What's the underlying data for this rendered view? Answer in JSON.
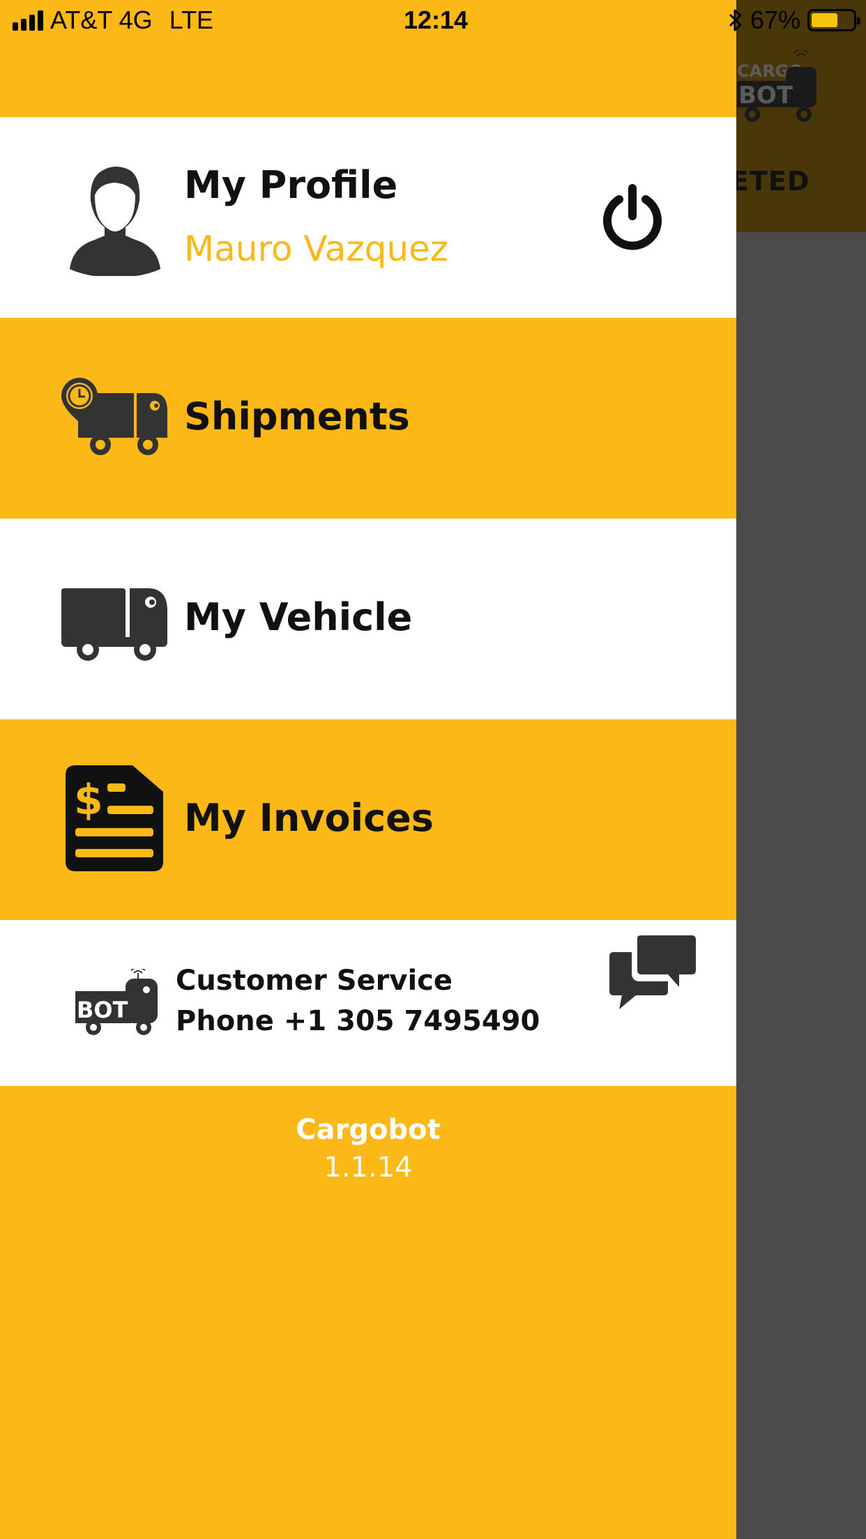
{
  "status_bar": {
    "carrier": "AT&T 4G",
    "network": "LTE",
    "time": "12:14",
    "bluetooth_icon": "bluetooth-icon",
    "battery_percent": "67%",
    "battery_level": 0.67,
    "battery_color": "#f7c40c"
  },
  "background_app": {
    "logo_text_top": "CARGO",
    "logo_text_bottom": "BOT",
    "tab_text_fragment": "ETED"
  },
  "drawer": {
    "profile": {
      "title": "My Profile",
      "name": "Mauro Vazquez",
      "avatar_icon": "user-avatar-icon",
      "logout_icon": "power-icon"
    },
    "items": [
      {
        "label": "Shipments",
        "icon": "truck-clock-icon"
      },
      {
        "label": "My Vehicle",
        "icon": "truck-icon"
      },
      {
        "label": "My Invoices",
        "icon": "invoice-icon"
      }
    ],
    "customer_service": {
      "line1": "Customer Service",
      "line2": "Phone +1 305 7495490",
      "logo_text": "BOT",
      "chat_icon": "chat-icon"
    },
    "footer": {
      "app_name": "Cargobot",
      "version": "1.1.14"
    }
  },
  "colors": {
    "accent": "#fbb816",
    "dark": "#333333",
    "white": "#ffffff",
    "overlay": "#4b4b4b"
  }
}
